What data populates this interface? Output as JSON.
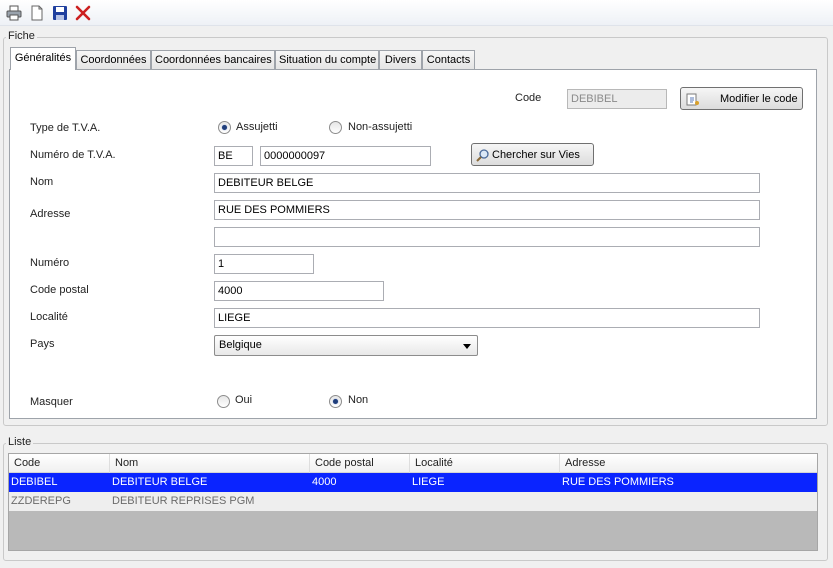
{
  "colors": {
    "selection": "#0a24ff",
    "delete_icon": "#cc1f1f",
    "save_icon": "#1f3f9e"
  },
  "toolbar": {
    "icons": [
      "print-icon",
      "new-document-icon",
      "save-icon",
      "delete-icon"
    ]
  },
  "fiche": {
    "title": "Fiche",
    "tabs": [
      "Généralités",
      "Coordonnées",
      "Coordonnées bancaires",
      "Situation du compte",
      "Divers",
      "Contacts"
    ],
    "active_tab": "Généralités",
    "code_label": "Code",
    "code_value": "DEBIBEL",
    "modify_code_button": "Modifier le code",
    "tva_type_label": "Type de T.V.A.",
    "tva_option_assujetti": "Assujetti",
    "tva_option_non_assujetti": "Non-assujetti",
    "tva_selected": "Assujetti",
    "tva_number_label": "Numéro de T.V.A.",
    "tva_country": "BE",
    "tva_number": "0000000097",
    "vies_button": "Chercher sur Vies",
    "nom_label": "Nom",
    "nom_value": "DEBITEUR BELGE",
    "adresse_label": "Adresse",
    "adresse_line1": "RUE DES POMMIERS",
    "adresse_line2": "",
    "numero_label": "Numéro",
    "numero_value": "1",
    "code_postal_label": "Code postal",
    "code_postal_value": "4000",
    "localite_label": "Localité",
    "localite_value": "LIEGE",
    "pays_label": "Pays",
    "pays_value": "Belgique",
    "masquer_label": "Masquer",
    "masquer_oui": "Oui",
    "masquer_non": "Non",
    "masquer_selected": "Non"
  },
  "liste": {
    "title": "Liste",
    "columns": [
      "Code",
      "Nom",
      "Code postal",
      "Localité",
      "Adresse"
    ],
    "rows": [
      {
        "code": "DEBIBEL",
        "nom": "DEBITEUR BELGE",
        "code_postal": "4000",
        "localite": "LIEGE",
        "adresse": "RUE DES POMMIERS",
        "selected": true
      },
      {
        "code": "ZZDEREPG",
        "nom": "DEBITEUR REPRISES PGM",
        "code_postal": "",
        "localite": "",
        "adresse": "",
        "selected": false
      }
    ]
  }
}
